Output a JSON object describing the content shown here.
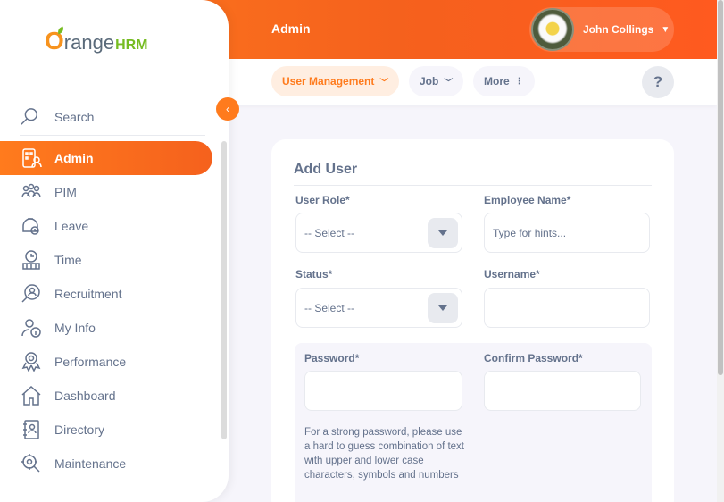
{
  "topbar": {
    "title": "Admin",
    "user_name": "John Collings"
  },
  "brand": {
    "logo_o": "O",
    "logo_range": "range",
    "logo_hrm": "HRM"
  },
  "sidebar": {
    "search_label": "Search",
    "items": [
      {
        "label": "Admin",
        "icon": "admin-icon",
        "active": true
      },
      {
        "label": "PIM",
        "icon": "pim-icon"
      },
      {
        "label": "Leave",
        "icon": "leave-icon"
      },
      {
        "label": "Time",
        "icon": "time-icon"
      },
      {
        "label": "Recruitment",
        "icon": "recruitment-icon"
      },
      {
        "label": "My Info",
        "icon": "my-info-icon"
      },
      {
        "label": "Performance",
        "icon": "performance-icon"
      },
      {
        "label": "Dashboard",
        "icon": "dashboard-icon"
      },
      {
        "label": "Directory",
        "icon": "directory-icon"
      },
      {
        "label": "Maintenance",
        "icon": "maintenance-icon"
      }
    ]
  },
  "subnav": {
    "tabs": [
      {
        "label": "User Management",
        "active": true
      },
      {
        "label": "Job"
      },
      {
        "label": "More"
      }
    ],
    "help": "?"
  },
  "form": {
    "title": "Add User",
    "user_role": {
      "label": "User Role*",
      "value": "-- Select --"
    },
    "employee_name": {
      "label": "Employee Name*",
      "placeholder": "Type for hints..."
    },
    "status": {
      "label": "Status*",
      "value": "-- Select --"
    },
    "username": {
      "label": "Username*",
      "value": ""
    },
    "password": {
      "label": "Password*",
      "value": ""
    },
    "confirm_password": {
      "label": "Confirm Password*",
      "value": ""
    },
    "password_hint": "For a strong password, please use a hard to guess combination of text with upper and lower case characters, symbols and numbers"
  },
  "colors": {
    "accent": "#ff7b1d",
    "text": "#64728c",
    "background": "#f6f5fb"
  }
}
